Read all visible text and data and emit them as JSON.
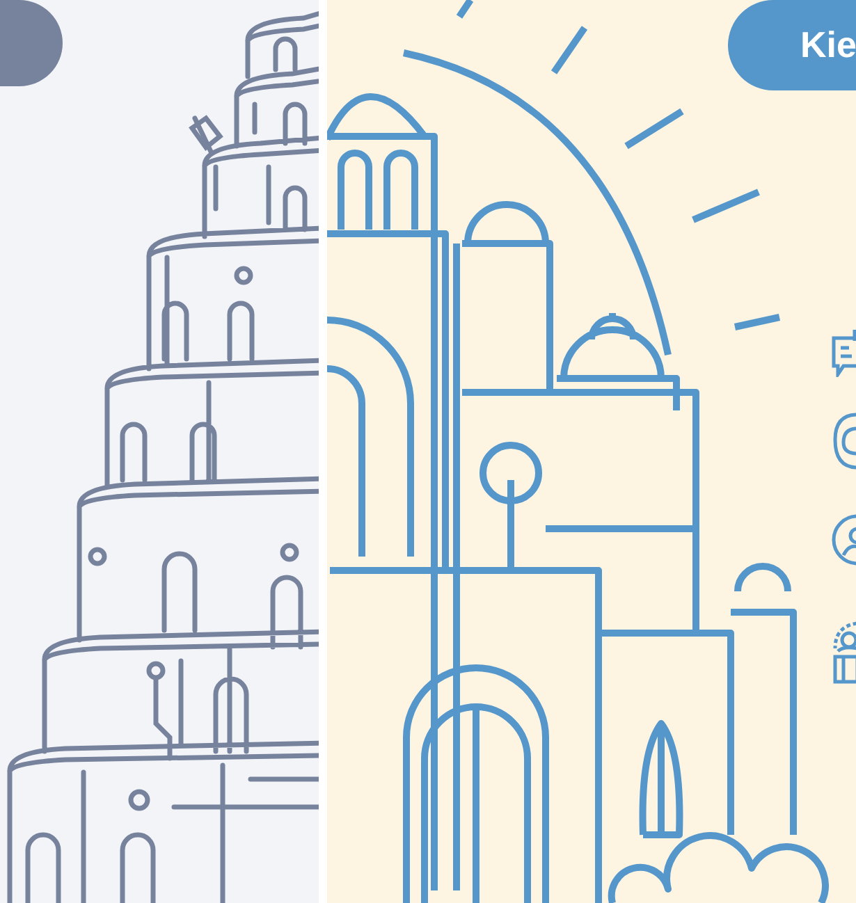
{
  "language_button": {
    "label": "Kie"
  }
}
